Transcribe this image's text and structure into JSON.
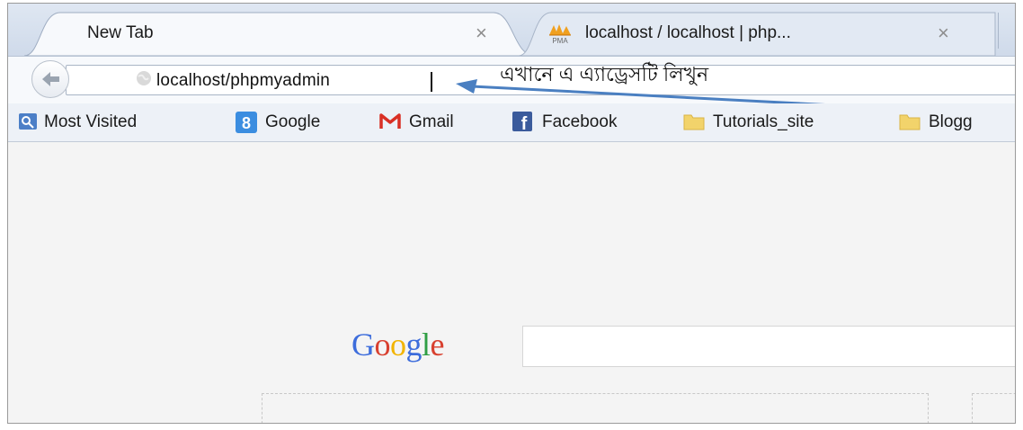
{
  "tabs": [
    {
      "title": "New Tab",
      "close_glyph": "×",
      "icon": "none"
    },
    {
      "title": "localhost / localhost | php...",
      "close_glyph": "×",
      "icon": "pma-icon",
      "icon_text": "PMA"
    }
  ],
  "navbar": {
    "url": "localhost/phpmyadmin",
    "annotation": "এখানে এ এ্যাড্রেসটি লিখুন",
    "annotation_arrow_color": "#4a7fc1"
  },
  "bookmarks": [
    {
      "label": "Most Visited",
      "icon": "most-visited-icon"
    },
    {
      "label": "Google",
      "icon": "google-plus-icon",
      "icon_text": "8"
    },
    {
      "label": "Gmail",
      "icon": "gmail-icon"
    },
    {
      "label": "Facebook",
      "icon": "facebook-icon",
      "icon_text": "f"
    },
    {
      "label": "Tutorials_site",
      "icon": "folder-icon"
    },
    {
      "label": "Blogg",
      "icon": "folder-icon"
    }
  ],
  "content": {
    "google_logo": [
      "G",
      "o",
      "o",
      "g",
      "l",
      "e"
    ],
    "google_logo_colors": [
      "#3d6ddc",
      "#d8402f",
      "#f2b400",
      "#3d6ddc",
      "#2f9e44",
      "#d8402f"
    ],
    "search_placeholder": ""
  }
}
